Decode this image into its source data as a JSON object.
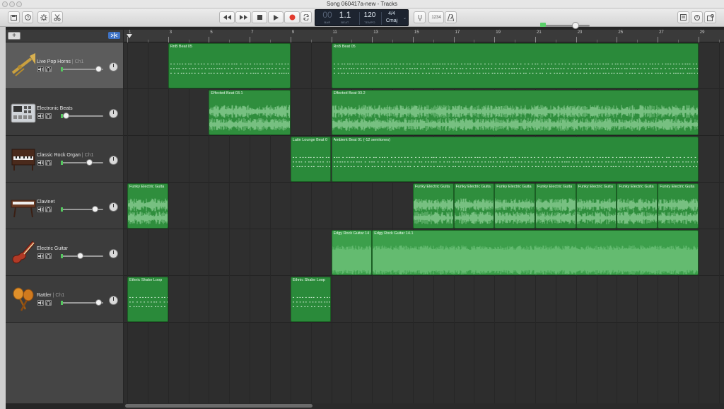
{
  "window": {
    "title": "Song 060417a-new - Tracks"
  },
  "toolbar": {
    "rewind": "rewind",
    "forward": "fast-forward",
    "stop": "stop",
    "play": "play",
    "record": "record",
    "cycle": "cycle",
    "tuner_label": "",
    "count_in_label": "1234",
    "metronome": "metronome"
  },
  "lcd": {
    "bar_label": "BAR",
    "beat_label": "BEAT",
    "tempo_label": "TEMPO",
    "position": "1.1",
    "position_prefix": "00",
    "tempo": "120",
    "signature": "4/4",
    "key": "Cmaj"
  },
  "master_volume": {
    "level": 0.7
  },
  "ruler": {
    "bars": [
      "1",
      "3",
      "5",
      "7",
      "9",
      "11",
      "13",
      "15",
      "17",
      "19",
      "21",
      "23",
      "25",
      "27",
      "29"
    ]
  },
  "tracks": [
    {
      "name": "Live Pop Horns",
      "channel": "Ch1",
      "icon": "trumpet-icon",
      "volume": 0.95,
      "selected": true
    },
    {
      "name": "Electronic Beats",
      "channel": "",
      "icon": "drum-machine-icon",
      "volume": 0.05,
      "selected": false
    },
    {
      "name": "Classic Rock Organ",
      "channel": "Ch1",
      "icon": "organ-icon",
      "volume": 0.7,
      "selected": false
    },
    {
      "name": "Clavinet",
      "channel": "",
      "icon": "clavinet-icon",
      "volume": 0.85,
      "selected": false
    },
    {
      "name": "Electric Guitar",
      "channel": "",
      "icon": "electric-guitar-icon",
      "volume": 0.45,
      "selected": false
    },
    {
      "name": "Rattler",
      "channel": "Ch1",
      "icon": "maracas-icon",
      "volume": 0.95,
      "selected": false
    }
  ],
  "regions": [
    {
      "track": 0,
      "name": "RnB Beat 05",
      "start": 3,
      "end": 9,
      "kind": "midi"
    },
    {
      "track": 0,
      "name": "RnB Beat 05",
      "start": 11,
      "end": 29,
      "kind": "midi"
    },
    {
      "track": 1,
      "name": "Effected Beat 03.1",
      "start": 5,
      "end": 9,
      "kind": "audio"
    },
    {
      "track": 1,
      "name": "Effected Beat 03.2",
      "start": 11,
      "end": 29,
      "kind": "audio"
    },
    {
      "track": 2,
      "name": "Latin Lounge Beat 0",
      "start": 9,
      "end": 11,
      "kind": "midi"
    },
    {
      "track": 2,
      "name": "Ambient Beat 01 (-12 semitones)",
      "start": 11,
      "end": 29,
      "kind": "midi"
    },
    {
      "track": 3,
      "name": "Funky Electric Guita",
      "start": 1,
      "end": 3,
      "kind": "audio"
    },
    {
      "track": 3,
      "name": "Funky Electric Guita",
      "start": 15,
      "end": 17,
      "kind": "audio"
    },
    {
      "track": 3,
      "name": "Funky Electric Guita",
      "start": 17,
      "end": 19,
      "kind": "audio"
    },
    {
      "track": 3,
      "name": "Funky Electric Guita",
      "start": 19,
      "end": 21,
      "kind": "audio"
    },
    {
      "track": 3,
      "name": "Funky Electric Guita",
      "start": 21,
      "end": 23,
      "kind": "audio"
    },
    {
      "track": 3,
      "name": "Funky Electric Guita",
      "start": 23,
      "end": 25,
      "kind": "audio"
    },
    {
      "track": 3,
      "name": "Funky Electric Guita",
      "start": 25,
      "end": 27,
      "kind": "audio"
    },
    {
      "track": 3,
      "name": "Funky Electric Guita",
      "start": 27,
      "end": 29,
      "kind": "audio"
    },
    {
      "track": 4,
      "name": "Edgy Rock Guitar 14",
      "start": 11,
      "end": 13,
      "kind": "dense"
    },
    {
      "track": 4,
      "name": "Edgy Rock Guitar 14.1",
      "start": 13,
      "end": 29,
      "kind": "dense"
    },
    {
      "track": 5,
      "name": "Ethnic Shake Loop",
      "start": 1,
      "end": 3,
      "kind": "midi"
    },
    {
      "track": 5,
      "name": "Ethnic Shake Loop",
      "start": 9,
      "end": 11,
      "kind": "midi"
    }
  ]
}
